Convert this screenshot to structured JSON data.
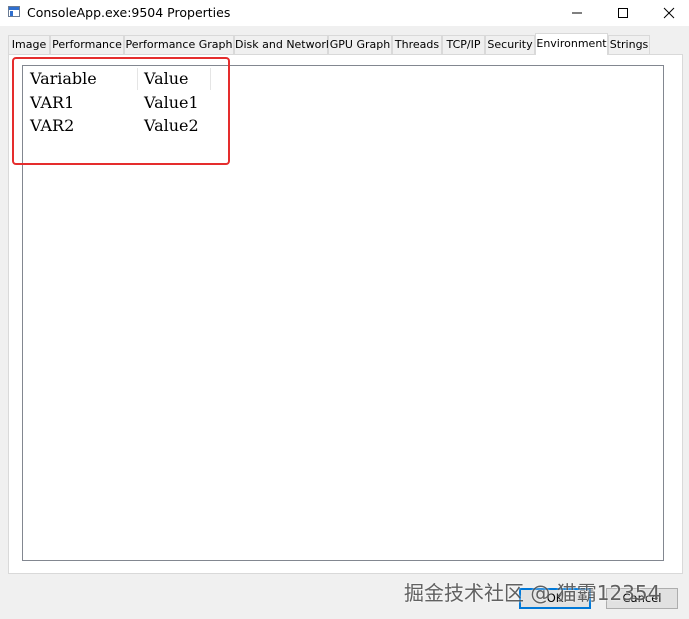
{
  "window": {
    "title": "ConsoleApp.exe:9504 Properties",
    "controls": [
      "minimize-icon",
      "maximize-icon",
      "close-icon"
    ]
  },
  "tabs": [
    {
      "label": "Image"
    },
    {
      "label": "Performance"
    },
    {
      "label": "Performance Graph"
    },
    {
      "label": "Disk and Network"
    },
    {
      "label": "GPU Graph"
    },
    {
      "label": "Threads"
    },
    {
      "label": "TCP/IP"
    },
    {
      "label": "Security"
    },
    {
      "label": "Environment",
      "active": true
    },
    {
      "label": "Strings"
    }
  ],
  "environment": {
    "columns": [
      "Variable",
      "Value"
    ],
    "rows": [
      {
        "variable": "VAR1",
        "value": "Value1"
      },
      {
        "variable": "VAR2",
        "value": "Value2"
      }
    ]
  },
  "buttons": {
    "ok": "OK",
    "cancel": "Cancel"
  },
  "annotation": {
    "highlight_color": "#e52d2d"
  },
  "watermark": "掘金技术社区 @ 猫霸12354"
}
